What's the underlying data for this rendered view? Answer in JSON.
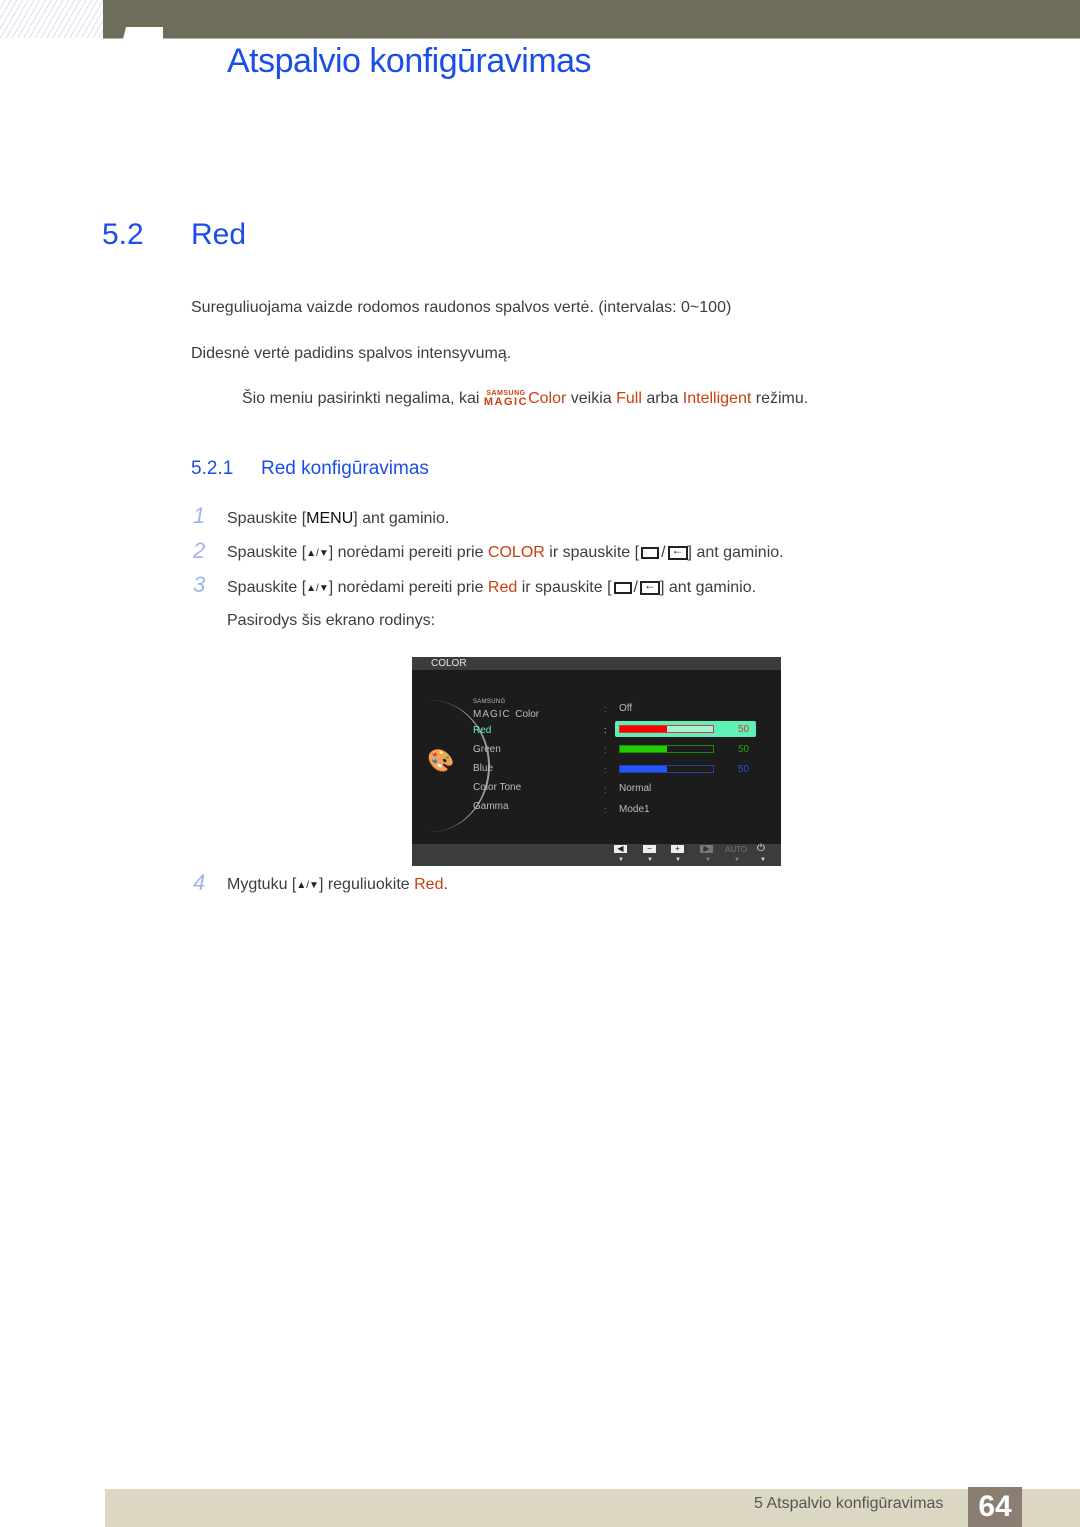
{
  "header": {
    "chapter_title": "Atspalvio konfigūravimas"
  },
  "section": {
    "number": "5.2",
    "title": "Red"
  },
  "paragraphs": [
    "Sureguliuojama vaizde rodomos raudonos spalvos vertė. (intervalas: 0~100)",
    "Didesnė vertė padidins spalvos intensyvumą."
  ],
  "note": {
    "prefix": "Šio meniu pasirinkti negalima, kai ",
    "magic_top": "SAMSUNG",
    "magic_bottom": "MAGIC",
    "magic_word": "Color",
    "middle1": " veikia ",
    "mode1": "Full",
    "middle2": " arba ",
    "mode2": "Intelligent",
    "suffix": " režimu."
  },
  "subsection": {
    "number": "5.2.1",
    "title": "Red konfigūravimas"
  },
  "steps": [
    {
      "num": "1",
      "pre": "Spauskite [",
      "key": "MENU",
      "post": "] ant gaminio."
    },
    {
      "num": "2",
      "pre": "Spauskite [",
      "arrows": "▲/▼",
      "mid": "] norėdami pereiti prie ",
      "target": "COLOR",
      "mid2": " ir spauskite [",
      "slash": "/",
      "post": "] ant gaminio."
    },
    {
      "num": "3",
      "pre": "Spauskite [",
      "arrows": "▲/▼",
      "mid": "] norėdami pereiti prie ",
      "target": "Red",
      "mid2": " ir spauskite [",
      "slash": "/",
      "post": "] ant gaminio."
    },
    {
      "num": "",
      "text": "Pasirodys šis ekrano rodinys:"
    },
    {
      "num": "4",
      "pre": "Mygtuku [",
      "arrows": "▲/▼",
      "mid": "] reguliuokite ",
      "target": "Red",
      "post": "."
    }
  ],
  "osd": {
    "title": "COLOR",
    "palette_icon": "🎨",
    "magic_top": "SAMSUNG",
    "magic_bottom": "MAGIC",
    "magic_word": "Color",
    "items": [
      {
        "label": "Red",
        "value_percent": 50,
        "number": "50",
        "color": "#ff0000"
      },
      {
        "label": "Green",
        "value_percent": 50,
        "number": "50",
        "color": "#22cc00"
      },
      {
        "label": "Blue",
        "value_percent": 50,
        "number": "50",
        "color": "#2255ff"
      },
      {
        "label": "Color Tone",
        "value": "Normal"
      },
      {
        "label": "Gamma",
        "value": "Mode1"
      }
    ],
    "magic_value": "Off",
    "colon": ":",
    "buttons": {
      "left": "◀",
      "minus": "−",
      "plus": "+",
      "play": "▶",
      "auto": "AUTO",
      "power": "⏻",
      "tri": "▼"
    }
  },
  "footer": {
    "chapter": "5 Atspalvio konfigūravimas",
    "page": "64"
  }
}
